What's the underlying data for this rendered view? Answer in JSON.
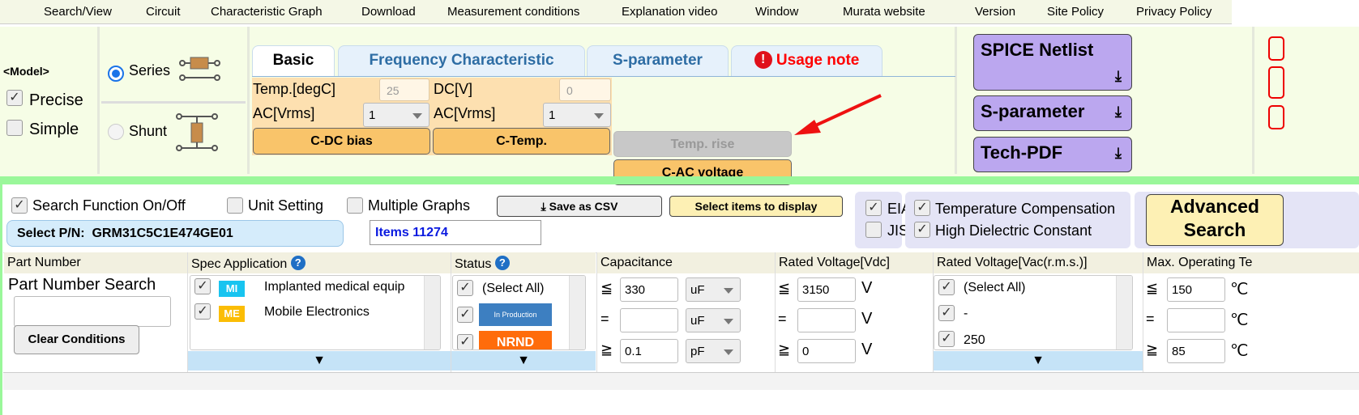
{
  "menu": [
    "Search/View",
    "Circuit",
    "Characteristic Graph",
    "Download",
    "Measurement conditions",
    "Explanation video",
    "Window",
    "Murata website",
    "Version",
    "Site Policy",
    "Privacy Policy"
  ],
  "model": {
    "label": "<Model>",
    "precise": "Precise",
    "precise_checked": true,
    "simple": "Simple",
    "simple_checked": false
  },
  "circuit": {
    "series": "Series",
    "series_selected": true,
    "shunt": "Shunt"
  },
  "tabs": [
    "Basic",
    "Frequency Characteristic",
    "S-parameter",
    "Usage note"
  ],
  "basic": {
    "temp_label": "Temp.[degC]",
    "temp_value": "25",
    "dc_label": "DC[V]",
    "dc_value": "0",
    "ac_label1": "AC[Vrms]",
    "ac_value1": "1",
    "ac_label2": "AC[Vrms]",
    "ac_value2": "1",
    "btn_cdc": "C-DC bias",
    "btn_ctemp": "C-Temp.",
    "btn_temprise": "Temp. rise",
    "btn_cac": "C-AC voltage"
  },
  "downloads": {
    "spice": "SPICE Netlist",
    "sparam": "S-parameter",
    "techpdf": "Tech-PDF"
  },
  "colors": {
    "accent_green": "#9af79a",
    "download_purple": "#bba7ef",
    "orange": "#f9c46a",
    "arrow": "#ee1111"
  },
  "search": {
    "func_label": "Search Function On/Off",
    "func_checked": true,
    "unit_label": "Unit Setting",
    "multi_label": "Multiple Graphs",
    "save_csv": "Save as CSV",
    "select_items": "Select items to display",
    "select_pn_label": "Select P/N:",
    "select_pn_value": "GRM31C5C1E474GE01",
    "items": "Items 11274",
    "eia": "EIA",
    "jis": "JIS",
    "temp_comp": "Temperature Compensation",
    "high_dielectric": "High Dielectric Constant",
    "advanced1": "Advanced",
    "advanced2": "Search"
  },
  "columns": {
    "part_number": {
      "header": "Part Number",
      "search_label": "Part Number Search",
      "clear": "Clear Conditions"
    },
    "spec_app": {
      "header": "Spec Application",
      "items": [
        {
          "badge": "MI",
          "text": "Implanted medical equip",
          "color": "#18c4f0"
        },
        {
          "badge": "ME",
          "text": "Mobile Electronics",
          "color": "#fbbd05"
        }
      ]
    },
    "status": {
      "header": "Status",
      "items": [
        "(Select All)",
        "In Production",
        "NRND"
      ]
    },
    "capacitance": {
      "header": "Capacitance",
      "rows": [
        {
          "sym": "≦",
          "val": "330",
          "unit": "uF"
        },
        {
          "sym": "=",
          "val": "",
          "unit": "uF"
        },
        {
          "sym": "≧",
          "val": "0.1",
          "unit": "pF"
        }
      ]
    },
    "rated_vdc": {
      "header": "Rated Voltage[Vdc]",
      "rows": [
        {
          "sym": "≦",
          "val": "3150",
          "unit": "V"
        },
        {
          "sym": "=",
          "val": "",
          "unit": "V"
        },
        {
          "sym": "≧",
          "val": "0",
          "unit": "V"
        }
      ]
    },
    "rated_vac": {
      "header": "Rated Voltage[Vac(r.m.s.)]",
      "items": [
        "(Select All)",
        "-",
        "250"
      ]
    },
    "max_temp": {
      "header": "Max. Operating Te",
      "rows": [
        {
          "sym": "≦",
          "val": "150",
          "unit": "℃"
        },
        {
          "sym": "=",
          "val": "",
          "unit": "℃"
        },
        {
          "sym": "≧",
          "val": "85",
          "unit": "℃"
        }
      ]
    }
  }
}
